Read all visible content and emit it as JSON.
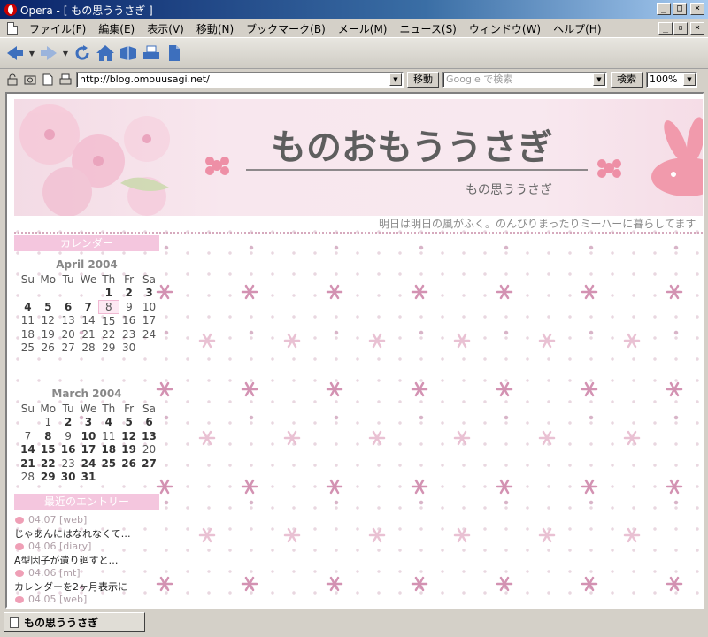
{
  "window": {
    "title": "Opera - [ もの思ううさぎ ]"
  },
  "menu": [
    "ファイル(F)",
    "編集(E)",
    "表示(V)",
    "移動(N)",
    "ブックマーク(B)",
    "メール(M)",
    "ニュース(S)",
    "ウィンドウ(W)",
    "ヘルプ(H)"
  ],
  "address": {
    "url": "http://blog.omouusagi.net/",
    "go_label": "移動",
    "search_placeholder": "Google で検索",
    "search_label": "検索",
    "zoom": "100%"
  },
  "page": {
    "banner_title": "ものおもううさぎ",
    "banner_subtitle": "もの思ううさぎ",
    "tagline": "明日は明日の風がふく。のんびりまったりミーハーに暮らしてます",
    "calendar_heading": "カレンダー",
    "recent_heading": "最近のエントリー"
  },
  "calendars": [
    {
      "month": "April 2004",
      "days": [
        "Su",
        "Mo",
        "Tu",
        "We",
        "Th",
        "Fr",
        "Sa"
      ],
      "weeks": [
        [
          "",
          "",
          "",
          "",
          "1",
          "2",
          "3"
        ],
        [
          "4",
          "5",
          "6",
          "7",
          "8",
          "9",
          "10"
        ],
        [
          "11",
          "12",
          "13",
          "14",
          "15",
          "16",
          "17"
        ],
        [
          "18",
          "19",
          "20",
          "21",
          "22",
          "23",
          "24"
        ],
        [
          "25",
          "26",
          "27",
          "28",
          "29",
          "30",
          ""
        ]
      ],
      "linked_days": [
        "1",
        "2",
        "3",
        "4",
        "5",
        "6",
        "7"
      ],
      "today": "8"
    },
    {
      "month": "March 2004",
      "days": [
        "Su",
        "Mo",
        "Tu",
        "We",
        "Th",
        "Fr",
        "Sa"
      ],
      "weeks": [
        [
          "",
          "1",
          "2",
          "3",
          "4",
          "5",
          "6"
        ],
        [
          "7",
          "8",
          "9",
          "10",
          "11",
          "12",
          "13"
        ],
        [
          "14",
          "15",
          "16",
          "17",
          "18",
          "19",
          "20"
        ],
        [
          "21",
          "22",
          "23",
          "24",
          "25",
          "26",
          "27"
        ],
        [
          "28",
          "29",
          "30",
          "31",
          "",
          "",
          ""
        ]
      ],
      "linked_days": [
        "2",
        "3",
        "4",
        "5",
        "6",
        "8",
        "10",
        "12",
        "13",
        "14",
        "15",
        "16",
        "17",
        "18",
        "19",
        "21",
        "22",
        "24",
        "25",
        "26",
        "27",
        "29",
        "30",
        "31"
      ],
      "today": ""
    }
  ],
  "entries": [
    {
      "meta": "04.07 [web]",
      "title": "じゃあんにはなれなくて…"
    },
    {
      "meta": "04.06 [diary]",
      "title": "A型因子が遺り廻すと…"
    },
    {
      "meta": "04.06 [mt]",
      "title": "カレンダーを2ヶ月表示に"
    },
    {
      "meta": "04.05 [web]",
      "title": ""
    }
  ],
  "status": {
    "tab_label": "もの思ううさぎ"
  },
  "colors": {
    "accent_pink": "#f4c6de",
    "banner_bg": "#f8e7ee",
    "title_bar": "#0a246a"
  }
}
